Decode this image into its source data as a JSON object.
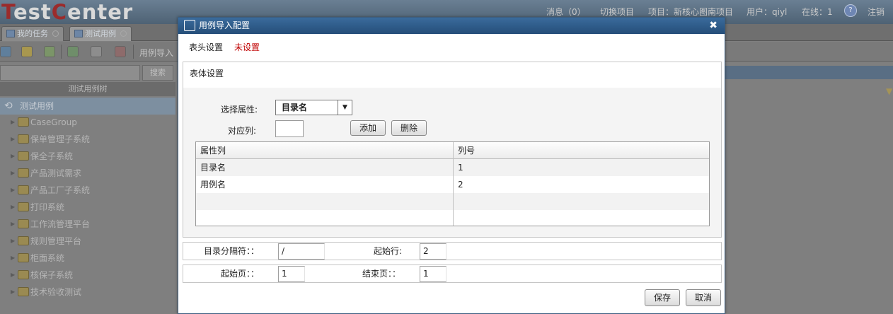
{
  "app": {
    "logo_text_a": "T",
    "logo_text_b": "est",
    "logo_text_c": "C",
    "logo_text_d": "enter",
    "nav": {
      "messages": "消息（0）",
      "switch_project": "切换项目",
      "project": "项目：新核心图南项目",
      "user": "用户：qiyl",
      "online": "在线：1",
      "logout": "注销"
    },
    "tabs": [
      {
        "label": "我的任务"
      },
      {
        "label": "测试用例"
      }
    ],
    "toolbar": {
      "import_label": "用例导入"
    },
    "search": {
      "button": "搜索"
    },
    "tree": {
      "header": "测试用例树",
      "root": "测试用例",
      "items": [
        "CaseGroup",
        "保单管理子系统",
        "保全子系统",
        "产品测试需求",
        "产品工厂子系统",
        "打印系统",
        "工作流管理平台",
        "规则管理平台",
        "柜面系统",
        "核保子系统",
        "技术验收测试"
      ]
    }
  },
  "dialog": {
    "title": "用例导入配置",
    "close_glyph": "✖",
    "header_settings": {
      "label": "表头设置",
      "status": "未设置",
      "status_color": "#c00000"
    },
    "body_settings": {
      "label": "表体设置",
      "attr_label": "选择属性:",
      "attr_selected": "目录名",
      "col_label": "对应列:",
      "col_value": "",
      "add_button": "添加",
      "delete_button": "删除",
      "table": {
        "columns": [
          "属性列",
          "列号"
        ],
        "rows": [
          [
            "目录名",
            "1"
          ],
          [
            "用例名",
            "2"
          ],
          [
            "",
            ""
          ],
          [
            "",
            ""
          ]
        ]
      }
    },
    "options": {
      "dir_sep_label": "目录分隔符：：",
      "dir_sep_value": "/",
      "start_row_label": "起始行:",
      "start_row_value": "2",
      "start_page_label": "起始页：：",
      "start_page_value": "1",
      "end_page_label": "结束页：：",
      "end_page_value": "1"
    },
    "save_button": "保存",
    "cancel_button": "取消"
  }
}
